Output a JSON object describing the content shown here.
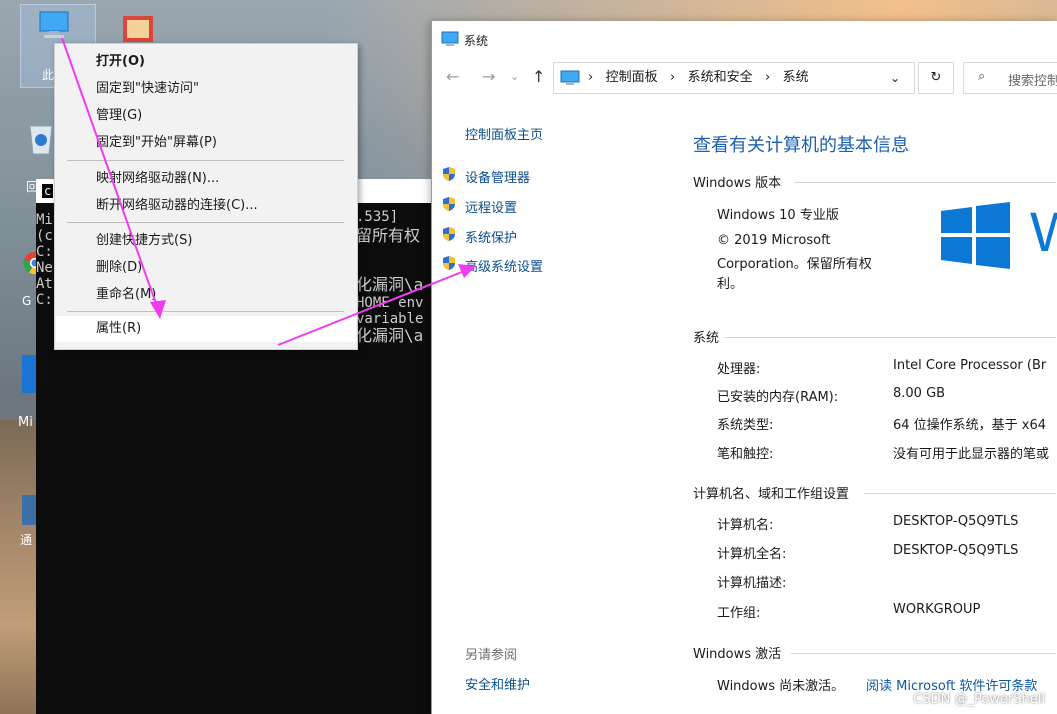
{
  "desktop": {
    "icons": [
      {
        "name": "this-pc-icon",
        "label": "此电"
      },
      {
        "name": "recycle-bin-icon",
        "label": "回"
      },
      {
        "name": "chrome-icon",
        "label": "G"
      },
      {
        "name": "edge-icon",
        "label": "Mi"
      },
      {
        "name": "shortcut-icon",
        "label": "通"
      }
    ],
    "colors": {
      "accent": "#0078d7"
    }
  },
  "console": {
    "title": "c",
    "lines": [
      "Mi",
      "(c",
      "",
      "C:",
      "Ne",
      "At",
      "C:"
    ],
    "right_lines": [
      ".535]",
      "留所有权",
      "",
      "化漏洞\\a",
      "HOME env",
      "variable",
      "化漏洞\\a"
    ]
  },
  "context_menu": {
    "items": [
      {
        "label": "打开(O)",
        "bold": true
      },
      {
        "label": "固定到\"快速访问\""
      },
      {
        "label": "管理(G)"
      },
      {
        "label": "固定到\"开始\"屏幕(P)"
      },
      {
        "label": "映射网络驱动器(N)..."
      },
      {
        "label": "断开网络驱动器的连接(C)..."
      },
      {
        "label": "创建快捷方式(S)"
      },
      {
        "label": "删除(D)"
      },
      {
        "label": "重命名(M)"
      },
      {
        "label": "属性(R)",
        "highlighted": true
      }
    ]
  },
  "window": {
    "title": "系统",
    "breadcrumb": [
      "控制面板",
      "系统和安全",
      "系统"
    ],
    "search_placeholder": "搜索控制",
    "left_nav": {
      "home": "控制面板主页",
      "links": [
        "设备管理器",
        "远程设置",
        "系统保护",
        "高级系统设置"
      ],
      "see_also_title": "另请参阅",
      "see_also": [
        "安全和维护"
      ]
    },
    "heading": "查看有关计算机的基本信息",
    "edition_section": "Windows 版本",
    "edition": "Windows 10 专业版",
    "copyright_lines": [
      "© 2019 Microsoft",
      "Corporation。保留所有权",
      "利。"
    ],
    "system_section": "系统",
    "system_rows": [
      {
        "key": "处理器:",
        "value": "Intel Core Processor (Br"
      },
      {
        "key": "已安装的内存(RAM):",
        "value": "8.00 GB"
      },
      {
        "key": "系统类型:",
        "value": "64 位操作系统，基于 x64"
      },
      {
        "key": "笔和触控:",
        "value": "没有可用于此显示器的笔或"
      }
    ],
    "computer_section": "计算机名、域和工作组设置",
    "computer_rows": [
      {
        "key": "计算机名:",
        "value": "DESKTOP-Q5Q9TLS"
      },
      {
        "key": "计算机全名:",
        "value": "DESKTOP-Q5Q9TLS"
      },
      {
        "key": "计算机描述:",
        "value": ""
      },
      {
        "key": "工作组:",
        "value": "WORKGROUP"
      }
    ],
    "activation_section": "Windows 激活",
    "activation_status": "Windows 尚未激活。",
    "activation_link": "阅读 Microsoft 软件许可条款",
    "logo_letter": "W",
    "logo_color": "#0a78d4"
  },
  "annotation": {
    "arrow_color": "#f03cf0"
  },
  "watermark": "CSDN @_PowerShell"
}
